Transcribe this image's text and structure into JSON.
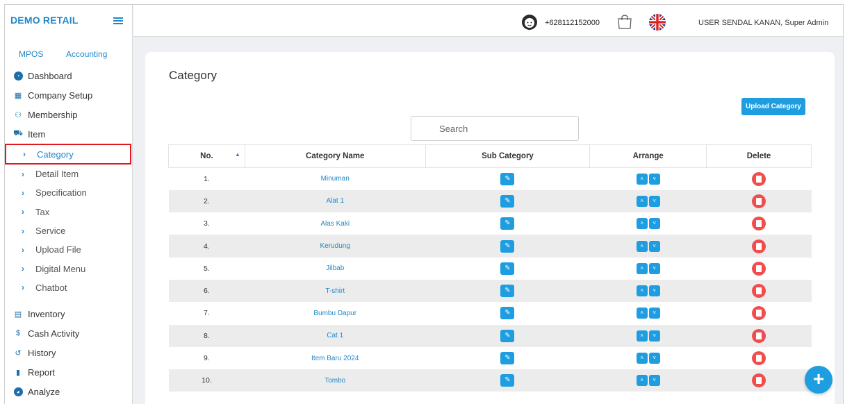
{
  "sidebar": {
    "brand": "DEMO RETAIL",
    "module_tabs": [
      "MPOS",
      "Accounting"
    ],
    "menu_top": [
      {
        "label": "Dashboard",
        "icon": "dashboard-icon"
      },
      {
        "label": "Company Setup",
        "icon": "building-icon"
      },
      {
        "label": "Membership",
        "icon": "users-icon"
      },
      {
        "label": "Item",
        "icon": "cart-icon"
      }
    ],
    "item_submenu": [
      "Category",
      "Detail Item",
      "Specification",
      "Tax",
      "Service",
      "Upload File",
      "Digital Menu",
      "Chatbot"
    ],
    "menu_bottom": [
      {
        "label": "Inventory",
        "icon": "list-icon"
      },
      {
        "label": "Cash Activity",
        "icon": "dollar-icon"
      },
      {
        "label": "History",
        "icon": "history-icon"
      },
      {
        "label": "Report",
        "icon": "file-icon"
      },
      {
        "label": "Analyze",
        "icon": "pie-chart-icon"
      }
    ],
    "active_item": "Category"
  },
  "topbar": {
    "phone": "+628112152000",
    "user": "USER SENDAL KANAN, Super Admin"
  },
  "page": {
    "title": "Category",
    "upload_label": "Upload Category",
    "search_placeholder": "Search"
  },
  "table": {
    "columns": [
      "No.",
      "Category Name",
      "Sub Category",
      "Arrange",
      "Delete"
    ],
    "rows": [
      {
        "no": "1.",
        "name": "Minuman"
      },
      {
        "no": "2.",
        "name": "Alat 1"
      },
      {
        "no": "3.",
        "name": "Alas Kaki"
      },
      {
        "no": "4.",
        "name": "Kerudung"
      },
      {
        "no": "5.",
        "name": "Jilbab"
      },
      {
        "no": "6.",
        "name": "T-shirt"
      },
      {
        "no": "7.",
        "name": "Bumbu Dapur"
      },
      {
        "no": "8.",
        "name": "Cat 1"
      },
      {
        "no": "9.",
        "name": "Item Baru 2024"
      },
      {
        "no": "10.",
        "name": "Tombo"
      }
    ]
  },
  "colors": {
    "accent": "#1e9ee0",
    "brand": "#1e88c8",
    "delete": "#f04e4e",
    "highlight_border": "#e0191f"
  }
}
